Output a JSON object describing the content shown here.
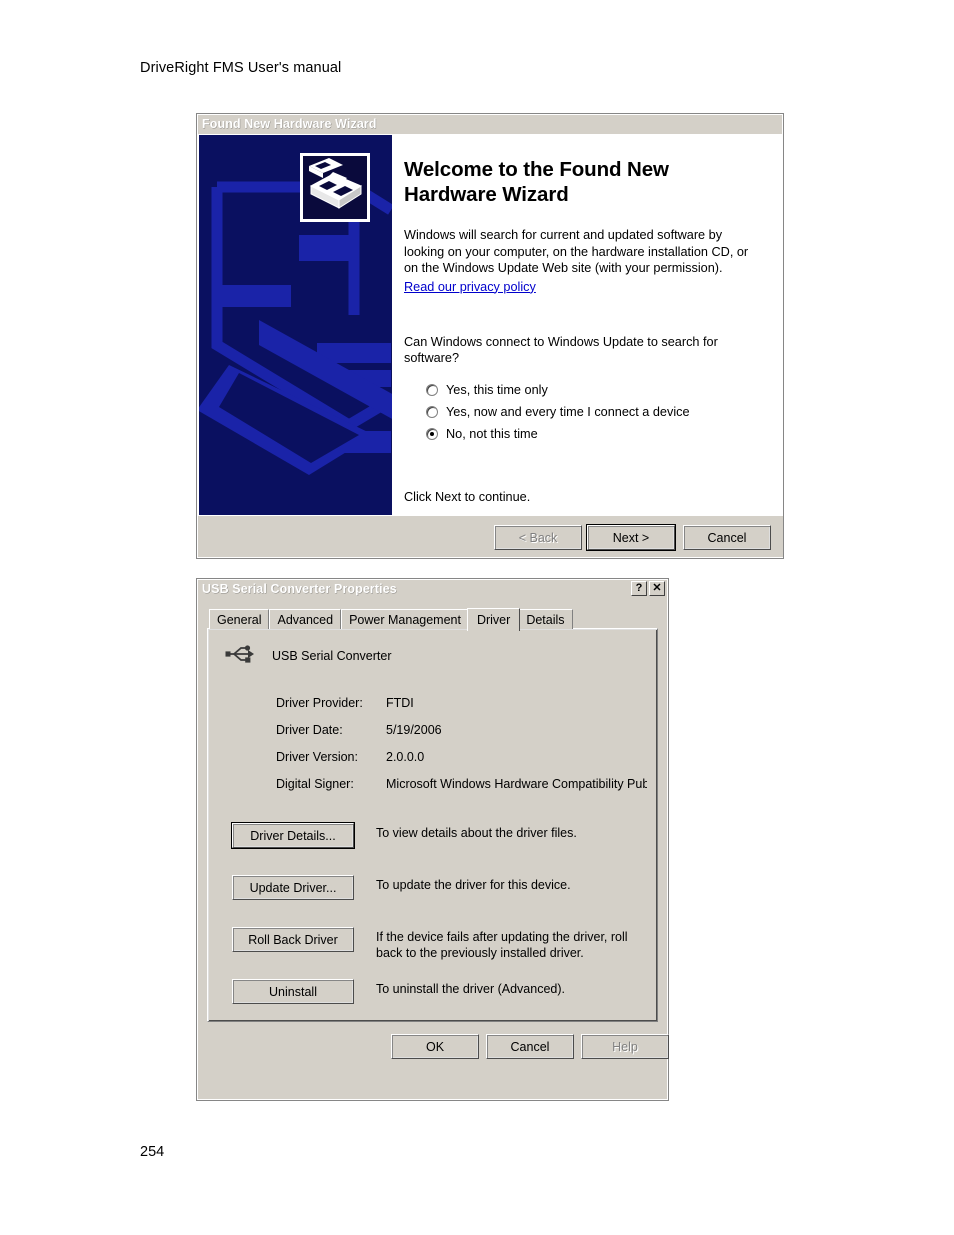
{
  "document": {
    "header": "DriveRight FMS User's manual",
    "page_number": "254"
  },
  "wizard": {
    "title": "Found New Hardware Wizard",
    "heading": "Welcome to the Found New Hardware Wizard",
    "intro": "Windows will search for current and updated software by looking on your computer, on the hardware installation CD, or on the Windows Update Web site (with your permission).",
    "privacy_link": "Read our privacy policy",
    "question": "Can Windows connect to Windows Update to search for software?",
    "options": [
      {
        "label": "Yes, this time only",
        "checked": false
      },
      {
        "label": "Yes, now and every time I connect a device",
        "checked": false
      },
      {
        "label": "No, not this time",
        "checked": true
      }
    ],
    "footer_text": "Click Next to continue.",
    "buttons": {
      "back": "< Back",
      "next": "Next >",
      "cancel": "Cancel"
    },
    "colors": {
      "banner_bg": "#0a1060",
      "banner_art": "#1a23a8",
      "title_left": "#0a246a",
      "title_right": "#a6c2f0",
      "link": "#0000cc"
    }
  },
  "properties": {
    "title": "USB Serial Converter Properties",
    "titlebar_buttons": {
      "help": "?",
      "close": "✕"
    },
    "tabs": [
      {
        "label": "General",
        "active": false
      },
      {
        "label": "Advanced",
        "active": false
      },
      {
        "label": "Power Management",
        "active": false
      },
      {
        "label": "Driver",
        "active": true
      },
      {
        "label": "Details",
        "active": false
      }
    ],
    "device_name": "USB Serial Converter",
    "device_icon": "usb-icon",
    "info": [
      {
        "label": "Driver Provider:",
        "value": "FTDI"
      },
      {
        "label": "Driver Date:",
        "value": "5/19/2006"
      },
      {
        "label": "Driver Version:",
        "value": "2.0.0.0"
      },
      {
        "label": "Digital Signer:",
        "value": "Microsoft Windows Hardware Compatibility Publ"
      }
    ],
    "actions": [
      {
        "button": "Driver Details...",
        "description": "To view details about the driver files.",
        "default": true
      },
      {
        "button": "Update Driver...",
        "description": "To update the driver for this device.",
        "default": false
      },
      {
        "button": "Roll Back Driver",
        "description": "If the device fails after updating the driver, roll back to the previously installed driver.",
        "default": false
      },
      {
        "button": "Uninstall",
        "description": "To uninstall the driver (Advanced).",
        "default": false
      }
    ],
    "buttons": {
      "ok": "OK",
      "cancel": "Cancel",
      "help": "Help"
    }
  }
}
